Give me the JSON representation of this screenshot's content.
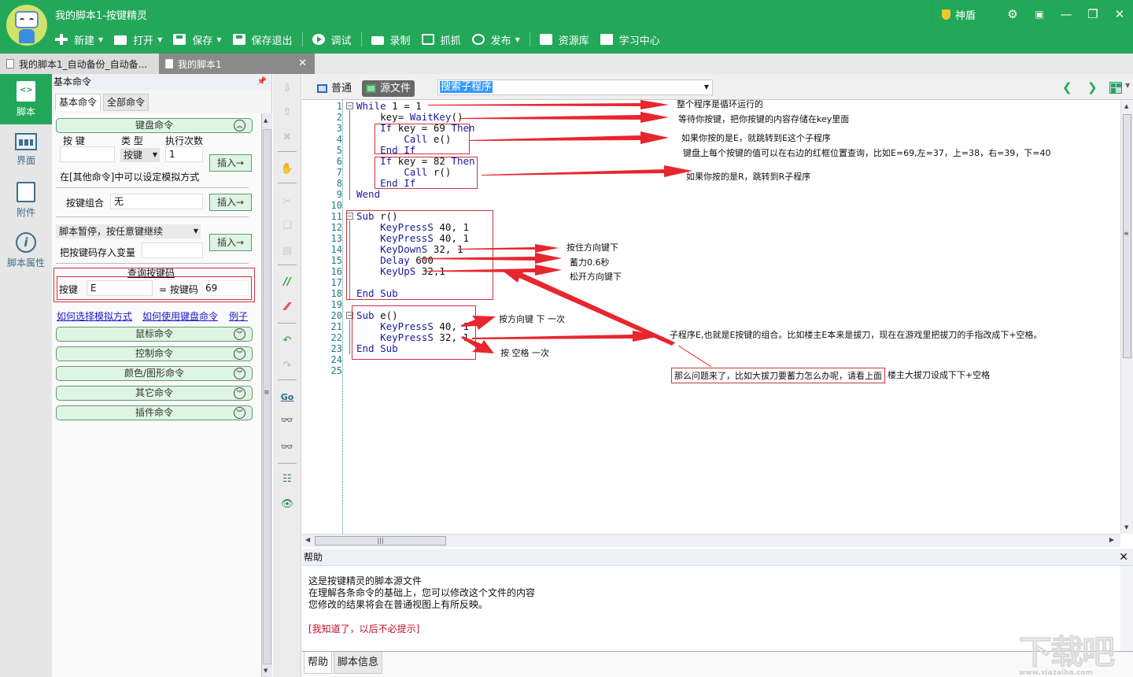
{
  "window": {
    "title": "我的脚本1-按键精灵",
    "shield_label": "神盾",
    "controls": [
      "settings",
      "skin",
      "minimize",
      "restore",
      "close"
    ]
  },
  "toolbar": {
    "items": [
      {
        "label": "新建",
        "icon": "plus-icon",
        "dropdown": true
      },
      {
        "label": "打开",
        "icon": "folder-icon",
        "dropdown": true
      },
      {
        "label": "保存",
        "icon": "save-icon",
        "dropdown": true
      },
      {
        "label": "保存退出",
        "icon": "save-exit-icon",
        "dropdown": false
      },
      {
        "label": "调试",
        "icon": "play-icon",
        "dropdown": false
      },
      {
        "label": "录制",
        "icon": "camera-icon",
        "dropdown": false
      },
      {
        "label": "抓抓",
        "icon": "grab-icon",
        "dropdown": false
      },
      {
        "label": "发布",
        "icon": "publish-icon",
        "dropdown": true
      },
      {
        "label": "资源库",
        "icon": "toolkit-icon",
        "dropdown": false
      },
      {
        "label": "学习中心",
        "icon": "book-icon",
        "dropdown": false
      }
    ]
  },
  "file_tabs": [
    {
      "label": "我的脚本1_自动备份_自动备...",
      "active": false
    },
    {
      "label": "我的脚本1",
      "active": true
    }
  ],
  "leftnav": {
    "items": [
      {
        "label": "脚本",
        "active": true
      },
      {
        "label": "界面",
        "active": false
      },
      {
        "label": "附件",
        "active": false
      },
      {
        "label": "脚本属性",
        "active": false
      }
    ]
  },
  "command_panel": {
    "title": "基本命令",
    "tabs": [
      {
        "label": "基本命令",
        "active": true
      },
      {
        "label": "全部命令",
        "active": false
      }
    ],
    "keyboard_section": {
      "title": "键盘命令",
      "key_label": "按 键",
      "type_label": "类 型",
      "count_label": "执行次数",
      "key_value": "",
      "type_value": "按键",
      "count_value": "1",
      "insert_label": "插入→",
      "note": "在[其他命令]中可以设定模拟方式",
      "combo_label": "按键组合",
      "combo_value": "无",
      "pause_option": "脚本暂停，按任意键继续",
      "store_label": "把按键码存入变量",
      "store_value": "",
      "lookup_title": "查询按键码",
      "lookup_key_label": "按键",
      "lookup_key_value": "E",
      "lookup_code_label": "= 按键码",
      "lookup_code_value": "69"
    },
    "links": [
      "如何选择模拟方式",
      "如何使用键盘命令",
      "例子"
    ],
    "sections": [
      "鼠标命令",
      "控制命令",
      "颜色/图形命令",
      "其它命令",
      "插件命令"
    ]
  },
  "editor": {
    "views": [
      {
        "label": "普通",
        "active": false
      },
      {
        "label": "源文件",
        "active": true
      }
    ],
    "sub_search": "搜索子程序",
    "lines": [
      "While 1 = 1",
      "    key= WaitKey()",
      "    If key = 69 Then",
      "        Call e()",
      "    End If",
      "    If key = 82 Then",
      "        Call r()",
      "    End If",
      "Wend",
      "",
      "Sub r()",
      "    KeyPressS 40, 1",
      "    KeyPressS 40, 1",
      "    KeyDownS 32, 1",
      "    Delay 600",
      "    KeyUpS 32,1",
      "",
      "End Sub",
      "",
      "Sub e()",
      "    KeyPressS 40, 1",
      "    KeyPressS 32, 1",
      "End Sub",
      "",
      ""
    ],
    "annotations": [
      "整个程序是循环运行的",
      "等待你按键，把你按键的内容存储在key里面",
      "如果你按的是E，就跳转到E这个子程序",
      "键盘上每个按键的值可以在右边的红框位置查询，比如E=69,左=37，上=38，右=39，下=40",
      "如果你按的是R，跳转到R子程序",
      "按住方向键下",
      "蓄力0.6秒",
      "松开方向键下",
      "按方向键 下 一次",
      "按 空格 一次",
      "子程序E,也就是E按键的组合。比如楼主E本来是拔刀，现在在游戏里把拔刀的手指改成下+空格。",
      "那么问题来了，比如大拔刀要蓄力怎么办呢，请看上面",
      "楼主大拔刀设成下下+空格"
    ]
  },
  "help": {
    "title": "帮助",
    "lines": [
      "这是按键精灵的脚本源文件",
      "在理解各条命令的基础上，您可以修改这个文件的内容",
      "您修改的结果将会在普通视图上有所反映。"
    ],
    "dismiss": "[我知道了，以后不必提示]",
    "tabs": [
      {
        "label": "帮助",
        "active": true
      },
      {
        "label": "脚本信息",
        "active": false
      }
    ]
  },
  "watermark": {
    "text": "下载吧",
    "url_text": "www.xiazaiba.com"
  },
  "colors": {
    "brand": "#23a758",
    "annotation_red": "#e8262e",
    "keyword_blue": "#1a1a9a"
  }
}
